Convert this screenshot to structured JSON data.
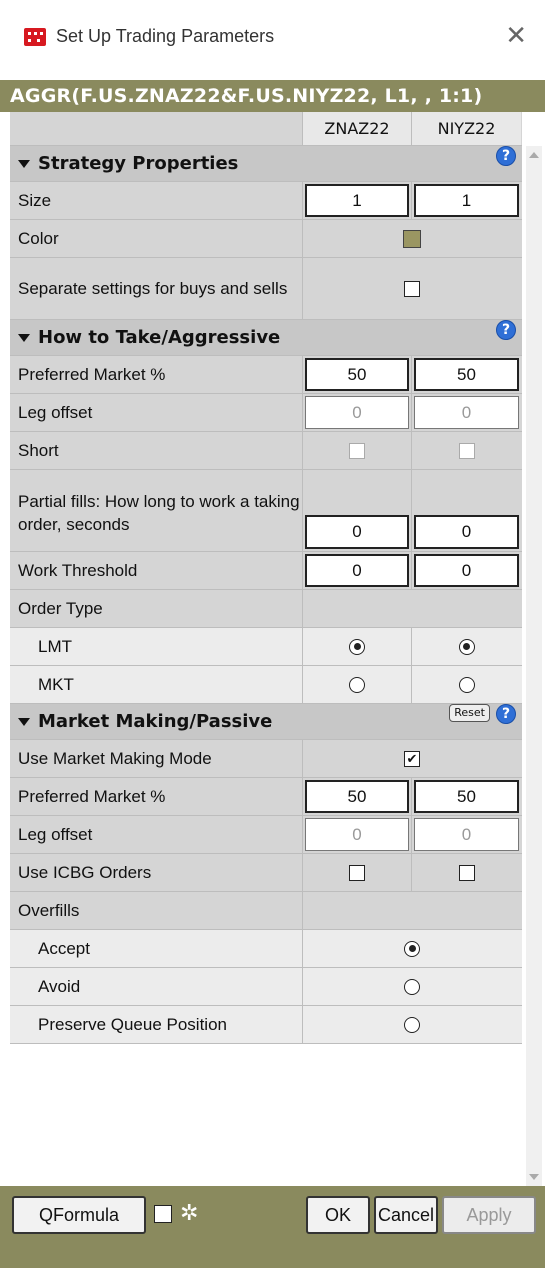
{
  "window": {
    "title": "Set Up Trading Parameters",
    "strategy": "AGGR(F.US.ZNAZ22&F.US.NIYZ22, L1, , 1:1)"
  },
  "columns": [
    "ZNAZ22",
    "NIYZ22"
  ],
  "sections": {
    "strategy_properties": "Strategy Properties",
    "how_to_take": "How to Take/Aggressive",
    "market_making": "Market Making/Passive"
  },
  "rows": {
    "size": {
      "label": "Size",
      "v1": "1",
      "v2": "1"
    },
    "color": {
      "label": "Color",
      "value": "#9a9662"
    },
    "separate": {
      "label": "Separate settings for buys and sells"
    },
    "pref_market": {
      "label": "Preferred Market %",
      "v1": "50",
      "v2": "50"
    },
    "leg_offset": {
      "label": "Leg offset",
      "v1": "0",
      "v2": "0"
    },
    "short": {
      "label": "Short"
    },
    "partial": {
      "label": "Partial fills: How long to work a taking order, seconds",
      "v1": "0",
      "v2": "0"
    },
    "work_threshold": {
      "label": "Work Threshold",
      "v1": "0",
      "v2": "0"
    },
    "order_type": {
      "label": "Order Type"
    },
    "lmt": {
      "label": "LMT"
    },
    "mkt": {
      "label": "MKT"
    },
    "use_mm": {
      "label": "Use Market Making Mode"
    },
    "pref_market2": {
      "label": "Preferred Market %",
      "v1": "50",
      "v2": "50"
    },
    "leg_offset2": {
      "label": "Leg offset",
      "v1": "0",
      "v2": "0"
    },
    "icbg": {
      "label": "Use ICBG Orders"
    },
    "overfills": {
      "label": "Overfills"
    },
    "accept": {
      "label": "Accept"
    },
    "avoid": {
      "label": "Avoid"
    },
    "preserve": {
      "label": "Preserve Queue Position"
    }
  },
  "buttons": {
    "reset": "Reset",
    "qformula": "QFormula",
    "ok": "OK",
    "cancel": "Cancel",
    "apply": "Apply"
  },
  "icons": {
    "help": "?",
    "check": "✔",
    "close": "✕",
    "gear": "✲"
  }
}
